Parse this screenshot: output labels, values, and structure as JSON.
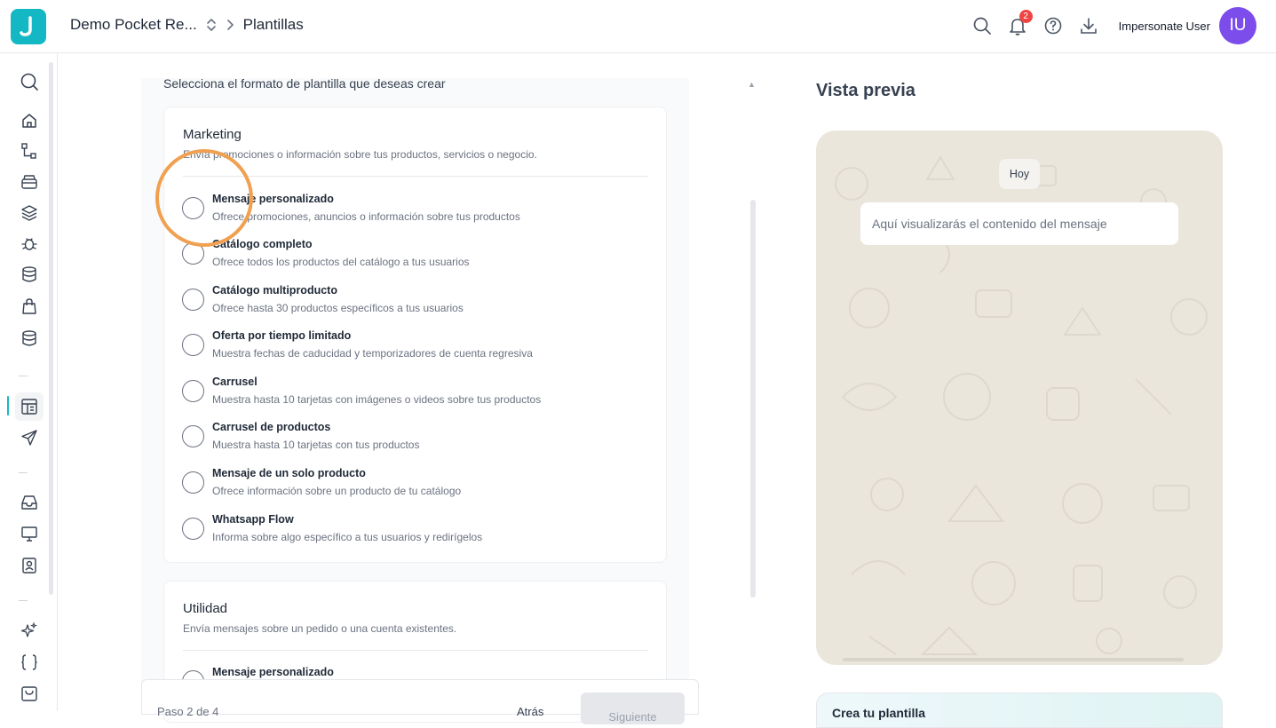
{
  "header": {
    "logo_letter": "J",
    "project": "Demo Pocket Re...",
    "page": "Plantillas",
    "notifications_count": "2",
    "user_name": "Impersonate User",
    "avatar_initials": "IU"
  },
  "form": {
    "prompt": "Selecciona el formato de plantilla que deseas crear",
    "marketing": {
      "title": "Marketing",
      "subtitle": "Envía promociones o información sobre tus productos, servicios o negocio.",
      "options": [
        {
          "title": "Mensaje personalizado",
          "desc": "Ofrece promociones, anuncios o información sobre tus productos"
        },
        {
          "title": "Catálogo completo",
          "desc": "Ofrece todos los productos del catálogo a tus usuarios"
        },
        {
          "title": "Catálogo multiproducto",
          "desc": "Ofrece hasta 30 productos específicos a tus usuarios"
        },
        {
          "title": "Oferta por tiempo limitado",
          "desc": "Muestra fechas de caducidad y temporizadores de cuenta regresiva"
        },
        {
          "title": "Carrusel",
          "desc": "Muestra hasta 10 tarjetas con imágenes o videos sobre tus productos"
        },
        {
          "title": "Carrusel de productos",
          "desc": "Muestra hasta 10 tarjetas con tus productos"
        },
        {
          "title": "Mensaje de un solo producto",
          "desc": "Ofrece información sobre un producto de tu catálogo"
        },
        {
          "title": "Whatsapp Flow",
          "desc": "Informa sobre algo específico a tus usuarios y redirígelos"
        }
      ]
    },
    "utilidad": {
      "title": "Utilidad",
      "subtitle": "Envía mensajes sobre un pedido o una cuenta existentes.",
      "options": [
        {
          "title": "Mensaje personalizado"
        }
      ]
    }
  },
  "footer": {
    "step": "Paso 2 de 4",
    "back_label": "Atrás",
    "next_label": "Siguiente"
  },
  "preview": {
    "title": "Vista previa",
    "date_chip": "Hoy",
    "placeholder": "Aquí visualizarás el contenido del mensaje",
    "create_card_title": "Crea tu plantilla"
  },
  "colors": {
    "brand": "#14b8c4",
    "avatar": "#7c4dea",
    "highlight": "#f0a050",
    "badge": "#ef4444"
  },
  "icons": {
    "sidebar": [
      "search-icon",
      "home-icon",
      "flow-icon",
      "inbox-tray-icon",
      "layers-icon",
      "bug-icon",
      "database-icon",
      "shopping-bag-icon",
      "database-stack-icon",
      "templates-icon",
      "send-icon",
      "inbox-icon",
      "monitor-icon",
      "contact-icon",
      "sparkles-icon",
      "braces-icon",
      "basket-icon"
    ]
  }
}
